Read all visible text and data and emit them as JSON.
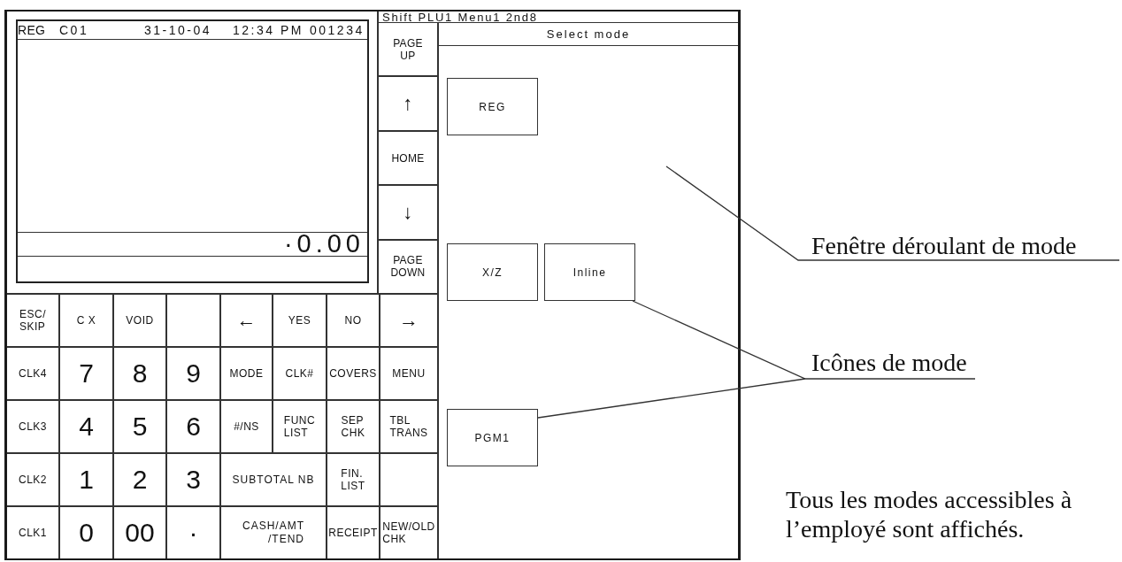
{
  "status_line": "Shift PLU1 Menu1 2nd8",
  "display": {
    "mode": "REG",
    "clerk": "C01",
    "date": "31-10-04",
    "time": "12:34 PM",
    "receipt": "001234",
    "amount": "·0.00"
  },
  "nav_keys": [
    {
      "kind": "text",
      "label": "PAGE\nUP"
    },
    {
      "kind": "arrow",
      "label": "↑"
    },
    {
      "kind": "text",
      "label": "HOME"
    },
    {
      "kind": "arrow",
      "label": "↓"
    },
    {
      "kind": "text",
      "label": "PAGE\nDOWN"
    }
  ],
  "keypad": {
    "rows": [
      [
        {
          "kind": "text",
          "label": "ESC/\nSKIP"
        },
        {
          "kind": "text",
          "label": "C X"
        },
        {
          "kind": "text",
          "label": "VOID"
        },
        {
          "kind": "blank"
        },
        {
          "kind": "arrow",
          "label": "←"
        },
        {
          "kind": "text",
          "label": "YES"
        },
        {
          "kind": "text",
          "label": "NO"
        },
        {
          "kind": "arrow",
          "label": "→"
        }
      ],
      [
        {
          "kind": "text",
          "label": "CLK4"
        },
        {
          "kind": "digit",
          "label": "7"
        },
        {
          "kind": "digit",
          "label": "8"
        },
        {
          "kind": "digit",
          "label": "9"
        },
        {
          "kind": "text",
          "label": "MODE"
        },
        {
          "kind": "text",
          "label": "CLK#"
        },
        {
          "kind": "text",
          "label": "COVERS"
        },
        {
          "kind": "text",
          "label": "MENU"
        }
      ],
      [
        {
          "kind": "text",
          "label": "CLK3"
        },
        {
          "kind": "digit",
          "label": "4"
        },
        {
          "kind": "digit",
          "label": "5"
        },
        {
          "kind": "digit",
          "label": "6"
        },
        {
          "kind": "text",
          "label": "#/NS"
        },
        {
          "kind": "text",
          "label": "FUNC\nLIST"
        },
        {
          "kind": "text",
          "label": "SEP\nCHK"
        },
        {
          "kind": "text",
          "label": "TBL\nTRANS"
        }
      ],
      [
        {
          "kind": "text",
          "label": "CLK2"
        },
        {
          "kind": "digit",
          "label": "1"
        },
        {
          "kind": "digit",
          "label": "2"
        },
        {
          "kind": "digit",
          "label": "3"
        },
        {
          "kind": "wide",
          "label": "SUBTOTAL NB"
        },
        "",
        {
          "kind": "text",
          "label": "FIN.\nLIST"
        },
        {
          "kind": "blank"
        }
      ],
      [
        {
          "kind": "text",
          "label": "CLK1"
        },
        {
          "kind": "digit",
          "label": "0"
        },
        {
          "kind": "digit",
          "label": "00"
        },
        {
          "kind": "digit",
          "label": "·"
        },
        {
          "kind": "wide",
          "label": "CASH/AMT\n/TEND"
        },
        "",
        {
          "kind": "text",
          "label": "RECEIPT"
        },
        {
          "kind": "text",
          "label": "NEW/OLD\nCHK"
        }
      ]
    ]
  },
  "mode_window": {
    "title": "Select mode",
    "rows": [
      {
        "icons": [
          {
            "label": "REG"
          }
        ]
      },
      {
        "icons": [
          {
            "label": "X/Z"
          },
          {
            "label": "Inline"
          }
        ]
      },
      {
        "icons": [
          {
            "label": "PGM1"
          }
        ]
      }
    ]
  },
  "callouts": [
    {
      "text": "Fenêtre déroulant de mode"
    },
    {
      "text": "Icônes de mode"
    }
  ],
  "caption": "Tous les modes accessibles à l’employé sont affichés."
}
